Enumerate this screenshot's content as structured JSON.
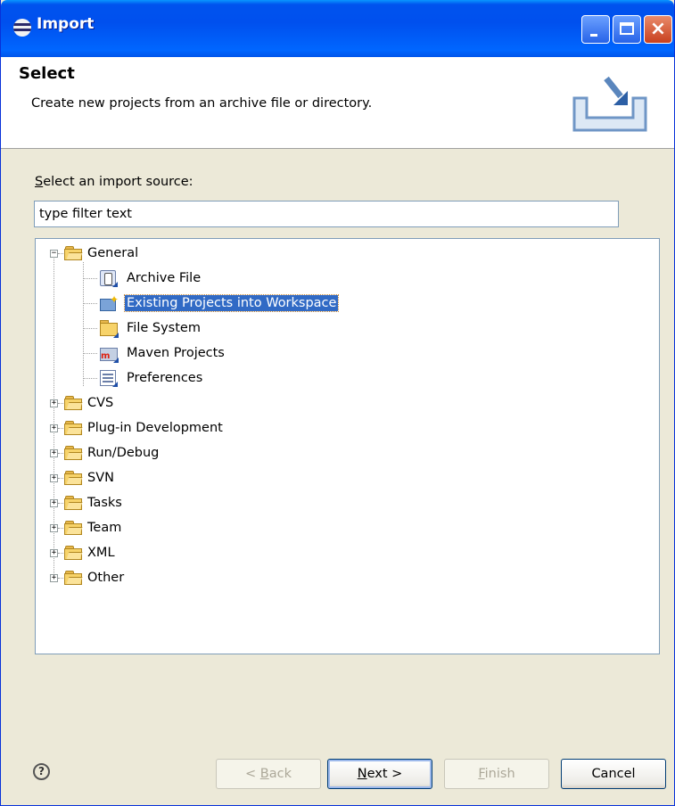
{
  "window": {
    "title": "Import"
  },
  "banner": {
    "title": "Select",
    "description": "Create new projects from an archive file or directory."
  },
  "filter": {
    "label_mnemonic": "S",
    "label_rest": "elect an import source:",
    "value": "type filter text"
  },
  "tree": {
    "general": {
      "label": "General",
      "children": [
        "Archive File",
        "Existing Projects into Workspace",
        "File System",
        "Maven Projects",
        "Preferences"
      ],
      "selected": "Existing Projects into Workspace"
    },
    "categories": [
      "CVS",
      "Plug-in Development",
      "Run/Debug",
      "SVN",
      "Tasks",
      "Team",
      "XML",
      "Other"
    ]
  },
  "buttons": {
    "help": "?",
    "back_pre": "< ",
    "back_mnemonic": "B",
    "back_rest": "ack",
    "next_mnemonic": "N",
    "next_rest": "ext >",
    "finish_mnemonic": "F",
    "finish_rest": "inish",
    "cancel": "Cancel"
  }
}
